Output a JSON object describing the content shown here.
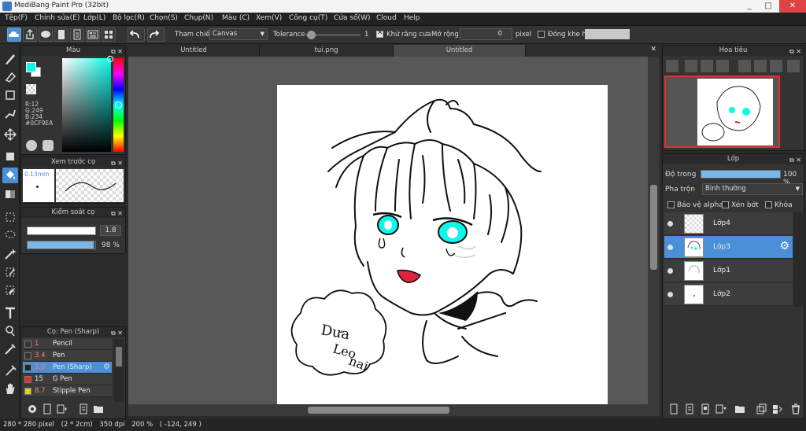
{
  "window": {
    "title": "MediBang Paint Pro (32bit)",
    "minimize": "_",
    "maximize": "□",
    "close": "✕"
  },
  "menu": [
    "Tệp(F)",
    "Chỉnh sửa(E)",
    "Lớp(L)",
    "Bộ lọc(R)",
    "Chọn(S)",
    "Chụp(N)",
    "Màu (C)",
    "Xem(V)",
    "Công cụ(T)",
    "Cửa sổ(W)",
    "Cloud",
    "Help"
  ],
  "toolbar": {
    "reference_label": "Tham chiếu",
    "reference_value": "Canvas",
    "tolerance_label": "Tolerance",
    "tolerance_value": "1",
    "antialias_label": "Khử răng cưa",
    "expand_label": "Mở rộng",
    "expand_value": "0",
    "expand_unit": "pixel",
    "close_gap_label": "Đóng khe hở",
    "tolerance_fraction": 0.03
  },
  "tabs": [
    {
      "label": "Untitled",
      "active": false
    },
    {
      "label": "tui.png",
      "active": false
    },
    {
      "label": "Untitled",
      "active": true
    }
  ],
  "color_panel": {
    "title": "Màu",
    "r": "R:12",
    "g": "G:249",
    "b": "B:234",
    "hex": "#0CF9EA",
    "fg_color": "#0CF9EA",
    "bg_color": "#FFFFFF"
  },
  "brush_preview": {
    "title": "Xem trước cọ",
    "size": "0.13mm"
  },
  "brush_control": {
    "title": "Kiểm soát cọ",
    "size_value": "1.8",
    "opacity_value": "98 %",
    "opacity_fraction": 0.98
  },
  "brush_panel": {
    "title": "Cọ: Pen (Sharp)",
    "items": [
      {
        "size": "1",
        "name": "Pencil",
        "color": "#333333",
        "selected": false
      },
      {
        "size": "3.4",
        "name": "Pen",
        "color": "#333333",
        "selected": false
      },
      {
        "size": "1.0",
        "name": "Pen (Sharp)",
        "color": "#222222",
        "selected": true
      },
      {
        "size": "15",
        "name": "G Pen",
        "color": "#e03030",
        "selected": false
      },
      {
        "size": "8.7",
        "name": "Stipple Pen",
        "color": "#e0d020",
        "selected": false
      }
    ]
  },
  "navigator": {
    "title": "Hoa tiêu"
  },
  "layers_panel": {
    "title": "Lớp",
    "opacity_label": "Độ trong",
    "opacity_value": "100 %",
    "opacity_fraction": 1.0,
    "blend_label": "Pha trộn",
    "blend_value": "Bình thường",
    "protect_alpha": "Bảo vệ alpha",
    "clip": "Xén bớt",
    "lock": "Khóa",
    "layers": [
      {
        "name": "Lớp4",
        "selected": false
      },
      {
        "name": "Lớp3",
        "selected": true
      },
      {
        "name": "Lớp1",
        "selected": false
      },
      {
        "name": "Lớp2",
        "selected": false
      }
    ]
  },
  "canvas_text": [
    "Dưa",
    "Leo",
    "nai"
  ],
  "status": {
    "size": "280 * 280 pixel",
    "cm": "(2 * 2cm)",
    "dpi": "350 dpi",
    "zoom": "200 %",
    "coords": "( -124, 249 )"
  }
}
